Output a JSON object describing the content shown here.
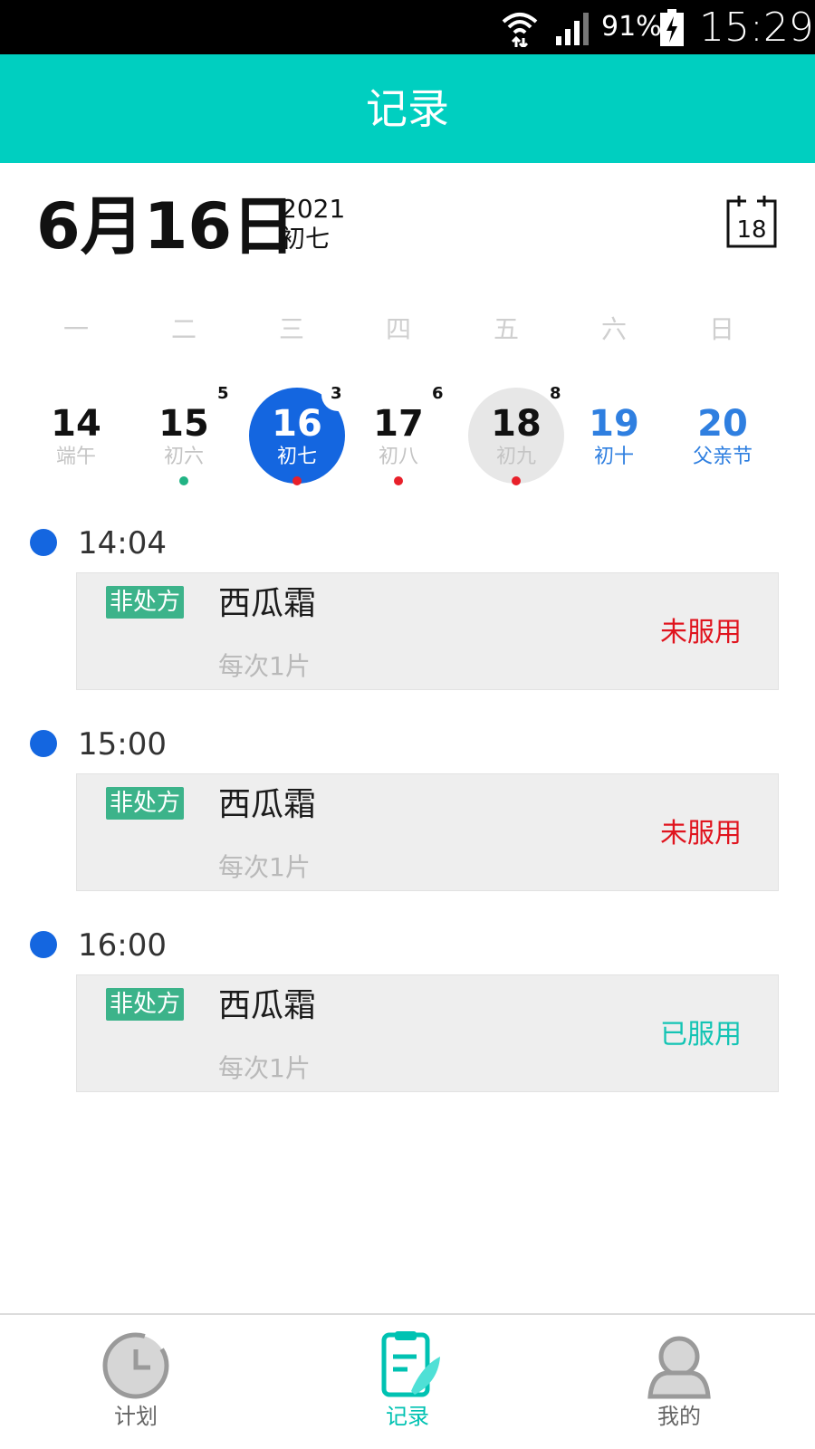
{
  "status_bar": {
    "battery_percent": "91%",
    "time": "15:29"
  },
  "header": {
    "title": "记录"
  },
  "date_header": {
    "date": "6月16日",
    "year": "2021",
    "lunar": "初七",
    "calendar_icon_day": "18"
  },
  "weekdays": [
    "一",
    "二",
    "三",
    "四",
    "五",
    "六",
    "日"
  ],
  "days": [
    {
      "num": "14",
      "lunar": "端午",
      "badge": "",
      "dot": ""
    },
    {
      "num": "15",
      "lunar": "初六",
      "badge": "5",
      "dot": "#21b384"
    },
    {
      "num": "16",
      "lunar": "初七",
      "badge": "3",
      "dot": "#e8202a"
    },
    {
      "num": "17",
      "lunar": "初八",
      "badge": "6",
      "dot": "#e8202a"
    },
    {
      "num": "18",
      "lunar": "初九",
      "badge": "8",
      "dot": "#e8202a"
    },
    {
      "num": "19",
      "lunar": "初十",
      "badge": "",
      "dot": ""
    },
    {
      "num": "20",
      "lunar": "父亲节",
      "badge": "",
      "dot": ""
    }
  ],
  "records": [
    {
      "time": "14:04",
      "tag": "非处方",
      "name": "西瓜霜",
      "dose": "每次1片",
      "status": "未服用",
      "status_color": "#e0141e"
    },
    {
      "time": "15:00",
      "tag": "非处方",
      "name": "西瓜霜",
      "dose": "每次1片",
      "status": "未服用",
      "status_color": "#e0141e"
    },
    {
      "time": "16:00",
      "tag": "非处方",
      "name": "西瓜霜",
      "dose": "每次1片",
      "status": "已服用",
      "status_color": "#13c4b4"
    }
  ],
  "bottom_nav": {
    "plan": "计划",
    "records": "记录",
    "mine": "我的"
  },
  "colors": {
    "accent": "#00cfc0",
    "selected_day": "#1466e0",
    "weekend": "#2f7fe0",
    "tag": "#3cb38a"
  }
}
